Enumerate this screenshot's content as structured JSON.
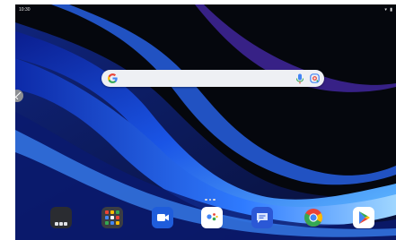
{
  "status_bar": {
    "time": "10:30",
    "icons": "▾ ▮"
  },
  "search_bar": {
    "logo": "google-g-icon",
    "mic": "microphone-icon",
    "lens": "google-lens-icon"
  },
  "home": {
    "page_indicator": "3 dots"
  },
  "dock": {
    "items": [
      {
        "name": "folder-icon"
      },
      {
        "name": "all-apps-icon"
      },
      {
        "name": "google-meet-icon"
      },
      {
        "name": "google-assistant-icon"
      },
      {
        "name": "messages-icon"
      },
      {
        "name": "chrome-icon"
      },
      {
        "name": "play-store-icon"
      }
    ]
  },
  "colors": {
    "wallpaper_dark": "#05070d",
    "wallpaper_blue": "#1a55e6",
    "wallpaper_light": "#4fa8ff",
    "search_bg": "#eef0f4"
  }
}
